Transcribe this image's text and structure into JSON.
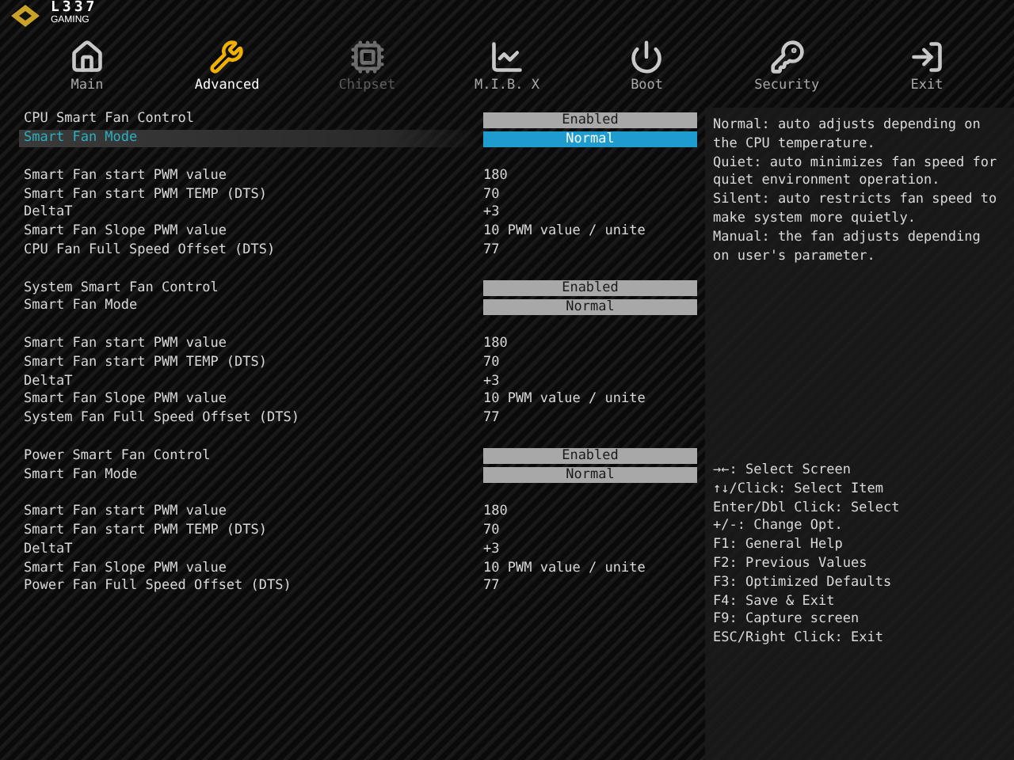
{
  "logo": {
    "title": "L337",
    "subtitle": "GAMING"
  },
  "tabs": [
    {
      "label": "Main",
      "selected": false,
      "disabled": false
    },
    {
      "label": "Advanced",
      "selected": true,
      "disabled": false
    },
    {
      "label": "Chipset",
      "selected": false,
      "disabled": true
    },
    {
      "label": "M.I.B. X",
      "selected": false,
      "disabled": false
    },
    {
      "label": "Boot",
      "selected": false,
      "disabled": false
    },
    {
      "label": "Security",
      "selected": false,
      "disabled": false
    },
    {
      "label": "Exit",
      "selected": false,
      "disabled": false
    }
  ],
  "settings": [
    {
      "kind": "option",
      "label": "CPU Smart Fan Control",
      "value": "Enabled",
      "selected": false
    },
    {
      "kind": "option",
      "label": "Smart Fan Mode",
      "value": "Normal",
      "selected": true
    },
    {
      "kind": "spacer"
    },
    {
      "kind": "value",
      "label": "Smart Fan start PWM value",
      "value": "180",
      "selected": false
    },
    {
      "kind": "value",
      "label": "Smart Fan start PWM TEMP (DTS)",
      "value": "70",
      "selected": false
    },
    {
      "kind": "value",
      "label": "DeltaT",
      "value": "+3",
      "selected": false
    },
    {
      "kind": "value",
      "label": "Smart Fan Slope PWM value",
      "value": "10 PWM value / unite",
      "selected": false
    },
    {
      "kind": "value",
      "label": "CPU Fan Full Speed Offset (DTS)",
      "value": "77",
      "selected": false
    },
    {
      "kind": "spacer"
    },
    {
      "kind": "option",
      "label": "System Smart Fan Control",
      "value": "Enabled",
      "selected": false
    },
    {
      "kind": "option",
      "label": "Smart Fan Mode",
      "value": "Normal",
      "selected": false
    },
    {
      "kind": "spacer"
    },
    {
      "kind": "value",
      "label": "Smart Fan start PWM value",
      "value": "180",
      "selected": false
    },
    {
      "kind": "value",
      "label": "Smart Fan start PWM TEMP (DTS)",
      "value": "70",
      "selected": false
    },
    {
      "kind": "value",
      "label": "DeltaT",
      "value": "+3",
      "selected": false
    },
    {
      "kind": "value",
      "label": "Smart Fan Slope PWM value",
      "value": "10 PWM value / unite",
      "selected": false
    },
    {
      "kind": "value",
      "label": "System Fan Full Speed Offset (DTS)",
      "value": "77",
      "selected": false
    },
    {
      "kind": "spacer"
    },
    {
      "kind": "option",
      "label": "Power Smart Fan Control",
      "value": "Enabled",
      "selected": false
    },
    {
      "kind": "option",
      "label": "Smart Fan Mode",
      "value": "Normal",
      "selected": false
    },
    {
      "kind": "spacer"
    },
    {
      "kind": "value",
      "label": "Smart Fan start PWM value",
      "value": "180",
      "selected": false
    },
    {
      "kind": "value",
      "label": "Smart Fan start PWM TEMP (DTS)",
      "value": "70",
      "selected": false
    },
    {
      "kind": "value",
      "label": "DeltaT",
      "value": "+3",
      "selected": false
    },
    {
      "kind": "value",
      "label": "Smart Fan Slope PWM value",
      "value": "10 PWM value / unite",
      "selected": false
    },
    {
      "kind": "value",
      "label": "Power Fan Full Speed Offset (DTS)",
      "value": "77",
      "selected": false
    }
  ],
  "help": [
    "Normal: auto adjusts depending on",
    "the CPU temperature.",
    "Quiet: auto minimizes fan speed for",
    "quiet environment operation.",
    "Silent: auto restricts fan speed to",
    "make system more quietly.",
    "Manual: the fan adjusts depending",
    "on user's parameter."
  ],
  "keys": [
    "→←: Select Screen",
    "↑↓/Click: Select Item",
    "Enter/Dbl Click: Select",
    "+/-: Change Opt.",
    "F1: General Help",
    "F2: Previous Values",
    "F3: Optimized Defaults",
    "F4: Save & Exit",
    "F9: Capture screen",
    "ESC/Right Click: Exit"
  ]
}
